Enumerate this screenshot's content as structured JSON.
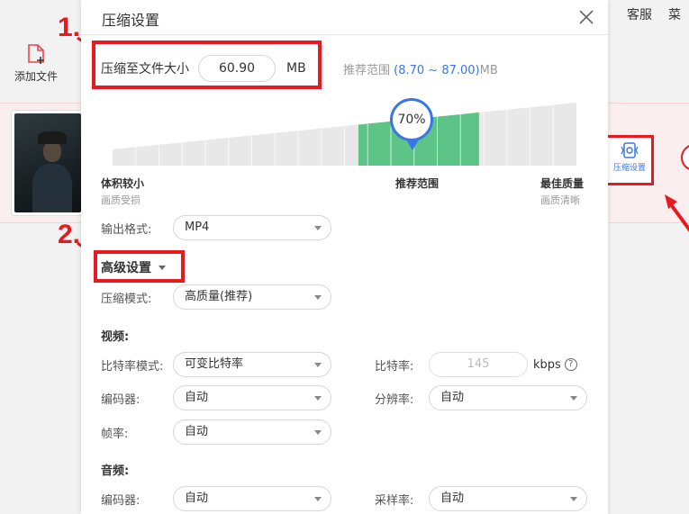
{
  "background": {
    "topbar": {
      "service": "客服",
      "menu": "菜"
    },
    "add_file_label": "添加文件",
    "settings_button_label": "压缩设置"
  },
  "annotations": {
    "step1": "1.",
    "step2": "2."
  },
  "dialog": {
    "title": "压缩设置",
    "compress_to_label": "压缩至文件大小",
    "target_size_value": "60.90",
    "size_unit": "MB",
    "recommend_prefix": "推荐范围",
    "recommend_range": "(8.70 ~ 87.00)",
    "recommend_unit": "MB",
    "slider": {
      "value_text": "70%",
      "value_percent": 70,
      "recommended_start_percent": 53,
      "recommended_end_percent": 79
    },
    "scale": {
      "left_title": "体积较小",
      "left_sub": "画质受损",
      "middle_title": "推荐范围",
      "right_title": "最佳质量",
      "right_sub": "画质清晰"
    },
    "output_format_label": "输出格式:",
    "output_format_value": "MP4",
    "advanced_label": "高级设置",
    "compress_mode_label": "压缩模式:",
    "compress_mode_value": "高质量(推荐)",
    "video_heading": "视频:",
    "bitrate_mode_label": "比特率模式:",
    "bitrate_mode_value": "可变比特率",
    "bitrate_label": "比特率:",
    "bitrate_value": "145",
    "bitrate_unit": "kbps",
    "help_icon_glyph": "?",
    "video_encoder_label": "编码器:",
    "video_encoder_value": "自动",
    "resolution_label": "分辨率:",
    "resolution_value": "自动",
    "framerate_label": "帧率:",
    "framerate_value": "自动",
    "audio_heading": "音频:",
    "audio_encoder_label": "编码器:",
    "audio_encoder_value": "自动",
    "samplerate_label": "采样率:",
    "samplerate_value": "自动"
  },
  "colors": {
    "accent_blue": "#3a76e8",
    "recommended_green": "#5cc487",
    "annotation_red": "#e8191f"
  }
}
